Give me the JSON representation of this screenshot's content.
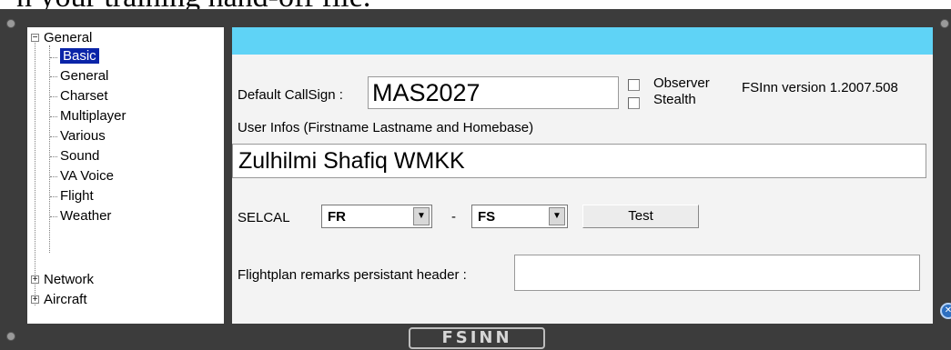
{
  "top_text": "n your training hand-off file.",
  "tree": {
    "general": "General",
    "children": [
      "Basic",
      "General",
      "Charset",
      "Multiplayer",
      "Various",
      "Sound",
      "VA Voice",
      "Flight",
      "Weather"
    ],
    "network": "Network",
    "aircraft": "Aircraft",
    "expander_open": "−",
    "expander_closed": "+"
  },
  "form": {
    "callsign_label": "Default CallSign :",
    "callsign_value": "MAS2027",
    "observer_label": "Observer",
    "stealth_label": "Stealth",
    "version": "FSInn version 1.2007.508",
    "userinfo_label": "User Infos (Firstname Lastname and Homebase)",
    "userinfo_value": "Zulhilmi Shafiq WMKK",
    "selcal_label": "SELCAL",
    "selcal_1": "FR",
    "selcal_dash": "-",
    "selcal_2": "FS",
    "test_button": "Test",
    "remarks_label": "Flightplan remarks persistant header :",
    "remarks_value": ""
  },
  "logo": "FSINN",
  "icons": {
    "dropdown": "chevron-down-icon",
    "close": "close-icon"
  },
  "colors": {
    "header_bar": "#5fd3f6",
    "panel": "#3c3c3c",
    "selection": "#0a24a8"
  }
}
